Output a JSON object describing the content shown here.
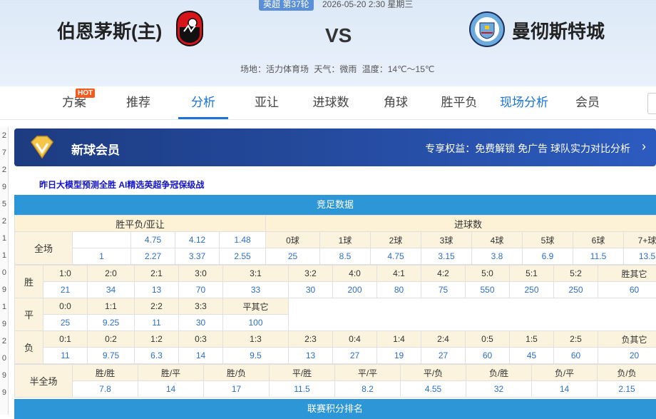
{
  "match": {
    "league_badge": "英超 第37轮",
    "time": "2026-05-20 2:30 星期三",
    "home": "伯恩茅斯(主)",
    "vs": "VS",
    "away": "曼彻斯特城",
    "venue": "场地：活力体育场",
    "weather": "天气：微雨",
    "temperature": "温度：14℃～15℃"
  },
  "tabs": [
    {
      "label": "方案"
    },
    {
      "label": "推荐"
    },
    {
      "label": "分析"
    },
    {
      "label": "亚让"
    },
    {
      "label": "进球数"
    },
    {
      "label": "角球"
    },
    {
      "label": "胜平负"
    },
    {
      "label": "现场分析"
    },
    {
      "label": "会员"
    }
  ],
  "hot_badge": "HOT",
  "left_strip": [
    "2",
    "7",
    "2",
    "9",
    "5",
    "2",
    "1",
    "1",
    "0",
    "9",
    "1",
    "9",
    "2",
    "0",
    "9",
    "9"
  ],
  "member": {
    "title": "新球会员",
    "benefits": "专享权益：免费解锁 免广告 球队实力对比分析"
  },
  "promo_link": "昨日大模型预测全胜 AI精选英超争冠保级战",
  "data_title": "竞足数据",
  "odds": {
    "wdl_header": "胜平负/亚让",
    "goals_header": "进球数",
    "full_label": "全场",
    "wdl_row1": [
      "",
      "4.75",
      "4.12",
      "1.48"
    ],
    "wdl_row2": [
      "1",
      "2.27",
      "3.37",
      "2.55"
    ],
    "goal_labels": [
      "0球",
      "1球",
      "2球",
      "3球",
      "4球",
      "5球",
      "6球",
      "7+球"
    ],
    "goal_values": [
      "25",
      "8.5",
      "4.75",
      "3.15",
      "3.8",
      "6.9",
      "11.5",
      "13.5"
    ]
  },
  "scores": {
    "win_label": "胜",
    "win_scores": [
      "1:0",
      "2:0",
      "2:1",
      "3:0",
      "3:1",
      "3:2",
      "4:0",
      "4:1",
      "4:2",
      "5:0",
      "5:1",
      "5:2",
      "胜其它"
    ],
    "win_odds": [
      "21",
      "34",
      "13",
      "70",
      "33",
      "30",
      "200",
      "80",
      "75",
      "550",
      "250",
      "250",
      "60"
    ],
    "draw_label": "平",
    "draw_scores": [
      "0:0",
      "1:1",
      "2:2",
      "3:3",
      "平其它"
    ],
    "draw_odds": [
      "25",
      "9.25",
      "11",
      "30",
      "100"
    ],
    "lose_label": "负",
    "lose_scores": [
      "0:1",
      "0:2",
      "1:2",
      "0:3",
      "1:3",
      "2:3",
      "0:4",
      "1:4",
      "2:4",
      "0:5",
      "1:5",
      "2:5",
      "负其它"
    ],
    "lose_odds": [
      "11",
      "9.75",
      "6.3",
      "14",
      "9.5",
      "13",
      "27",
      "19",
      "27",
      "60",
      "45",
      "60",
      "20"
    ]
  },
  "halffull": {
    "label": "半全场",
    "names": [
      "胜/胜",
      "胜/平",
      "胜/负",
      "平/胜",
      "平/平",
      "平/负",
      "负/胜",
      "负/平",
      "负/负"
    ],
    "odds": [
      "7.8",
      "14",
      "17",
      "11.5",
      "8.2",
      "4.55",
      "32",
      "14",
      "2.15"
    ]
  },
  "bottom_title": "联赛积分排名",
  "colors": {
    "accent": "#1a73d9",
    "table_header_bar": "#2d96d7",
    "odds_text": "#2e6fc6",
    "label_bg": "#fbf3dd"
  }
}
